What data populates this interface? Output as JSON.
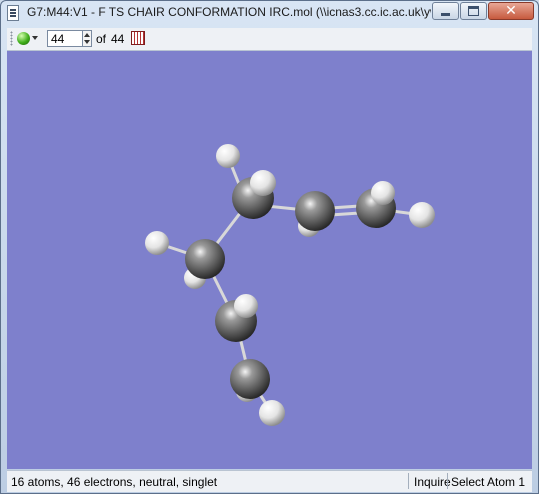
{
  "window": {
    "title": "G7:M44:V1 - F TS CHAIR CONFORMATION IRC.mol (\\\\icnas3.cc.ic.ac.uk\\yw...",
    "close_glyph": "✕"
  },
  "toolbar": {
    "frame_value": "44",
    "of_label": "of",
    "total_frames": "44"
  },
  "status": {
    "summary": "16 atoms, 46 electrons, neutral, singlet",
    "mode": "Inquire",
    "action": "Select Atom 1"
  },
  "colors": {
    "viewer_background": "#7e80cc",
    "carbon": "#5f5f5f",
    "hydrogen": "#e6e6e6"
  }
}
